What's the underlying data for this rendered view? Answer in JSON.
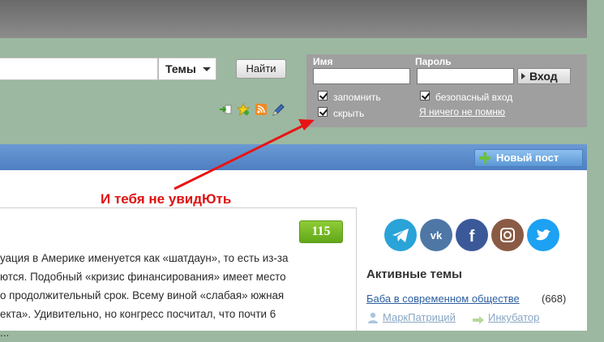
{
  "search": {
    "query": "",
    "scope": "Темы",
    "button": "Найти"
  },
  "login": {
    "name_label": "Имя",
    "password_label": "Пароль",
    "enter_label": "Вход",
    "remember_label": "запомнить",
    "secure_label": "безопасный вход",
    "hide_label": "скрыть",
    "forgot_label": "Я ничего не помню"
  },
  "toolbar_icons": [
    "arrow-page-icon",
    "star-icon",
    "rss-icon",
    "pencil-icon"
  ],
  "new_post_label": "Новый пост",
  "annotation": "И тебя не увидЮть",
  "article": {
    "score": "115",
    "lines": [
      "уация в Америке именуется как «шатдаун», то есть из-за",
      "ются. Подобный «кризис финансирования» имеет место",
      "о продолжительный срок. Всему виной «слабая» южная",
      "екта». Удивительно, но конгресс посчитал, что почти 6",
      "               ..."
    ]
  },
  "social_icons": [
    {
      "name": "telegram-icon",
      "color": "#2aa3d8"
    },
    {
      "name": "vk-icon",
      "color": "#4e77a6"
    },
    {
      "name": "facebook-icon",
      "color": "#3b5998"
    },
    {
      "name": "instagram-icon",
      "color": "#8a5a44"
    },
    {
      "name": "twitter-icon",
      "color": "#1da1f2"
    }
  ],
  "sidebar": {
    "title": "Активные темы",
    "topic_title": "Баба в современном обществе",
    "topic_count": "(668)",
    "author": "МаркПатриций",
    "section": "Инкубатор"
  },
  "colors": {
    "background": "#9cb8a0",
    "header": "#6a6a6a",
    "login_panel": "#9f9f9f",
    "blue_bar": "#5a8ccb",
    "score_green": "#6aad1c",
    "annotation_red": "#e01010"
  }
}
